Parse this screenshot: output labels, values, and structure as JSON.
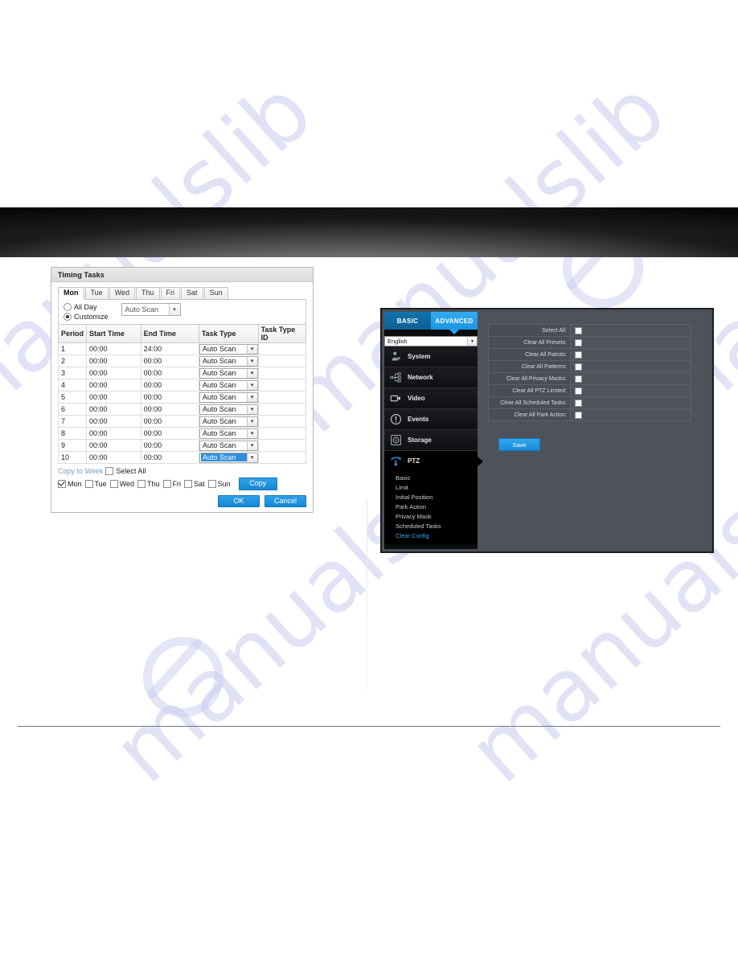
{
  "timing_dialog": {
    "title": "Timing Tasks",
    "day_tabs": [
      "Mon",
      "Tue",
      "Wed",
      "Thu",
      "Fri",
      "Sat",
      "Sun"
    ],
    "active_day_tab": "Mon",
    "mode": {
      "all_day_label": "All Day",
      "customize_label": "Customize",
      "selected": "Customize",
      "all_day_task": "Auto Scan"
    },
    "table": {
      "headers": [
        "Period",
        "Start Time",
        "End Time",
        "Task Type",
        "Task Type ID"
      ],
      "rows": [
        {
          "period": "1",
          "start": "00:00",
          "end": "24:00",
          "task": "Auto Scan",
          "id": "",
          "selected": false
        },
        {
          "period": "2",
          "start": "00:00",
          "end": "00:00",
          "task": "Auto Scan",
          "id": "",
          "selected": false
        },
        {
          "period": "3",
          "start": "00:00",
          "end": "00:00",
          "task": "Auto Scan",
          "id": "",
          "selected": false
        },
        {
          "period": "4",
          "start": "00:00",
          "end": "00:00",
          "task": "Auto Scan",
          "id": "",
          "selected": false
        },
        {
          "period": "5",
          "start": "00:00",
          "end": "00:00",
          "task": "Auto Scan",
          "id": "",
          "selected": false
        },
        {
          "period": "6",
          "start": "00:00",
          "end": "00:00",
          "task": "Auto Scan",
          "id": "",
          "selected": false
        },
        {
          "period": "7",
          "start": "00:00",
          "end": "00:00",
          "task": "Auto Scan",
          "id": "",
          "selected": false
        },
        {
          "period": "8",
          "start": "00:00",
          "end": "00:00",
          "task": "Auto Scan",
          "id": "",
          "selected": false
        },
        {
          "period": "9",
          "start": "00:00",
          "end": "00:00",
          "task": "Auto Scan",
          "id": "",
          "selected": false
        },
        {
          "period": "10",
          "start": "00:00",
          "end": "00:00",
          "task": "Auto Scan",
          "id": "",
          "selected": true
        }
      ]
    },
    "copy": {
      "copy_to_week_label": "Copy to Week",
      "select_all_label": "Select All",
      "select_all_checked": false,
      "days": [
        {
          "label": "Mon",
          "checked": true
        },
        {
          "label": "Tue",
          "checked": false
        },
        {
          "label": "Wed",
          "checked": false
        },
        {
          "label": "Thu",
          "checked": false
        },
        {
          "label": "Fri",
          "checked": false
        },
        {
          "label": "Sat",
          "checked": false
        },
        {
          "label": "Sun",
          "checked": false
        }
      ],
      "copy_button": "Copy"
    },
    "footer": {
      "ok": "OK",
      "cancel": "Cancel"
    }
  },
  "camera_panel": {
    "mode_tabs": {
      "basic": "BASIC",
      "advanced": "ADVANCED",
      "active": "ADVANCED"
    },
    "language": {
      "value": "English"
    },
    "nav": [
      {
        "label": "System",
        "icon": "system-icon",
        "active": false
      },
      {
        "label": "Network",
        "icon": "network-icon",
        "active": false
      },
      {
        "label": "Video",
        "icon": "video-icon",
        "active": false
      },
      {
        "label": "Events",
        "icon": "events-icon",
        "active": false
      },
      {
        "label": "Storage",
        "icon": "storage-icon",
        "active": false
      },
      {
        "label": "PTZ",
        "icon": "ptz-icon",
        "active": true
      }
    ],
    "submenu": [
      {
        "label": "Basic",
        "active": false
      },
      {
        "label": "Limit",
        "active": false
      },
      {
        "label": "Initial Position",
        "active": false
      },
      {
        "label": "Park Action",
        "active": false
      },
      {
        "label": "Privacy Mask",
        "active": false
      },
      {
        "label": "Scheduled Tasks",
        "active": false
      },
      {
        "label": "Clear Config",
        "active": true
      }
    ],
    "form_rows": [
      {
        "label": "Select All:",
        "checked": false
      },
      {
        "label": "Clear All Presets:",
        "checked": false
      },
      {
        "label": "Clear All Patrols:",
        "checked": false
      },
      {
        "label": "Clear All Patterns:",
        "checked": false
      },
      {
        "label": "Clear All Privacy Masks:",
        "checked": false
      },
      {
        "label": "Clear All PTZ Limited:",
        "checked": false
      },
      {
        "label": "Clear All Scheduled Tasks:",
        "checked": false
      },
      {
        "label": "Clear All Park Action:",
        "checked": false
      }
    ],
    "save_button": "Save"
  },
  "watermark": {
    "text": "manualslib"
  },
  "colors": {
    "accent_blue": "#2fa0e8",
    "tab_active_blue": "#30acf2",
    "panel_bg": "#4e535b",
    "sidebar_bg": "#0c0c0e",
    "link_blue": "#31a9ef",
    "watermark": "#c9cbee"
  }
}
